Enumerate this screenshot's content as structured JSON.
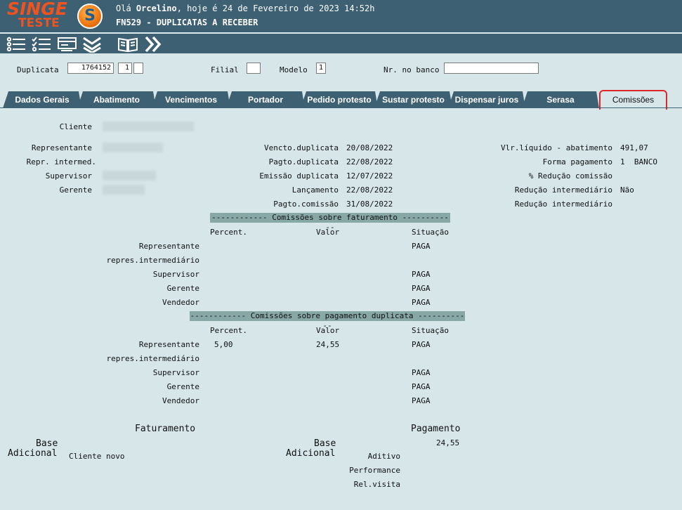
{
  "header": {
    "logo_top": "SINGE",
    "logo_bottom": "TESTE",
    "logo_mark": "S",
    "greeting_prefix": "Olá ",
    "greeting_user": "Orcelino",
    "greeting_suffix": ", hoje é 24 de Fevereiro de 2023 14:52h",
    "title": "FN529 - DUPLICATAS A RECEBER"
  },
  "toolbar": {
    "icons": [
      "list-icon",
      "checklist-icon",
      "card-icon",
      "double-chevron-down-icon",
      "book-icon",
      "double-chevron-right-icon"
    ]
  },
  "fields": {
    "duplicata_label": "Duplicata",
    "duplicata_value": "1764152",
    "duplicata_seq": "1",
    "duplicata_extra": "",
    "filial_label": "Filial",
    "filial_value": "",
    "modelo_label": "Modelo",
    "modelo_value": "1",
    "nr_banco_label": "Nr. no banco",
    "nr_banco_value": ""
  },
  "tabs": [
    "Dados Gerais",
    "Abatimento",
    "Vencimentos",
    "Portador",
    "Pedido protesto",
    "Sustar protesto",
    "Dispensar juros",
    "Serasa",
    "Comissões"
  ],
  "active_tab": "Comissões",
  "info": {
    "cliente_label": "Cliente",
    "representante_label": "Representante",
    "repr_intermed_label": "Repr. intermed.",
    "supervisor_label": "Supervisor",
    "gerente_label": "Gerente",
    "vencto_label": "Vencto.duplicata",
    "vencto_value": "20/08/2022",
    "pagto_label": "Pagto.duplicata",
    "pagto_value": "22/08/2022",
    "emissao_label": "Emissão duplicata",
    "emissao_value": "12/07/2022",
    "lancamento_label": "Lançamento",
    "lancamento_value": "22/08/2022",
    "pagto_comissao_label": "Pagto.comissão",
    "pagto_comissao_value": "31/08/2022",
    "vlr_liquido_label": "Vlr.líquido - abatimento",
    "vlr_liquido_value": "491,07",
    "forma_pagamento_label": "Forma pagamento",
    "forma_pagamento_value": "1  BANCO",
    "reducao_comissao_label": "% Redução comissão",
    "reducao_interm_label": "Redução intermediário",
    "reducao_interm_value": "Não",
    "reducao_interm2_label": "Redução intermediário"
  },
  "faturamento": {
    "header": "------------ Comissões sobre faturamento ------------",
    "col_percent": "Percent.",
    "col_valor": "Valor",
    "col_situacao": "Situação",
    "rows": [
      {
        "label": "Representante",
        "percent": "",
        "valor": "",
        "situacao": "PAGA"
      },
      {
        "label": "repres.intermediário",
        "percent": "",
        "valor": "",
        "situacao": ""
      },
      {
        "label": "Supervisor",
        "percent": "",
        "valor": "",
        "situacao": "PAGA"
      },
      {
        "label": "Gerente",
        "percent": "",
        "valor": "",
        "situacao": "PAGA"
      },
      {
        "label": "Vendedor",
        "percent": "",
        "valor": "",
        "situacao": "PAGA"
      }
    ]
  },
  "pagamento": {
    "header": "------------ Comissões sobre pagamento duplicata ------------",
    "col_percent": "Percent.",
    "col_valor": "Valor",
    "col_situacao": "Situação",
    "rows": [
      {
        "label": "Representante",
        "percent": "5,00",
        "valor": "24,55",
        "situacao": "PAGA"
      },
      {
        "label": "repres.intermediário",
        "percent": "",
        "valor": "",
        "situacao": ""
      },
      {
        "label": "Supervisor",
        "percent": "",
        "valor": "",
        "situacao": "PAGA"
      },
      {
        "label": "Gerente",
        "percent": "",
        "valor": "",
        "situacao": "PAGA"
      },
      {
        "label": "Vendedor",
        "percent": "",
        "valor": "",
        "situacao": "PAGA"
      }
    ]
  },
  "bottom": {
    "faturamento_title": "Faturamento",
    "pagamento_title": "Pagamento",
    "base_label": "Base",
    "adicional_label": "Adicional",
    "cliente_novo_label": "Cliente novo",
    "base_pag_label": "Base",
    "adicional_pag_label": "Adicional",
    "pagamento_base_value": "24,55",
    "aditivo_label": "Aditivo",
    "performance_label": "Performance",
    "rel_visita_label": "Rel.visita"
  }
}
